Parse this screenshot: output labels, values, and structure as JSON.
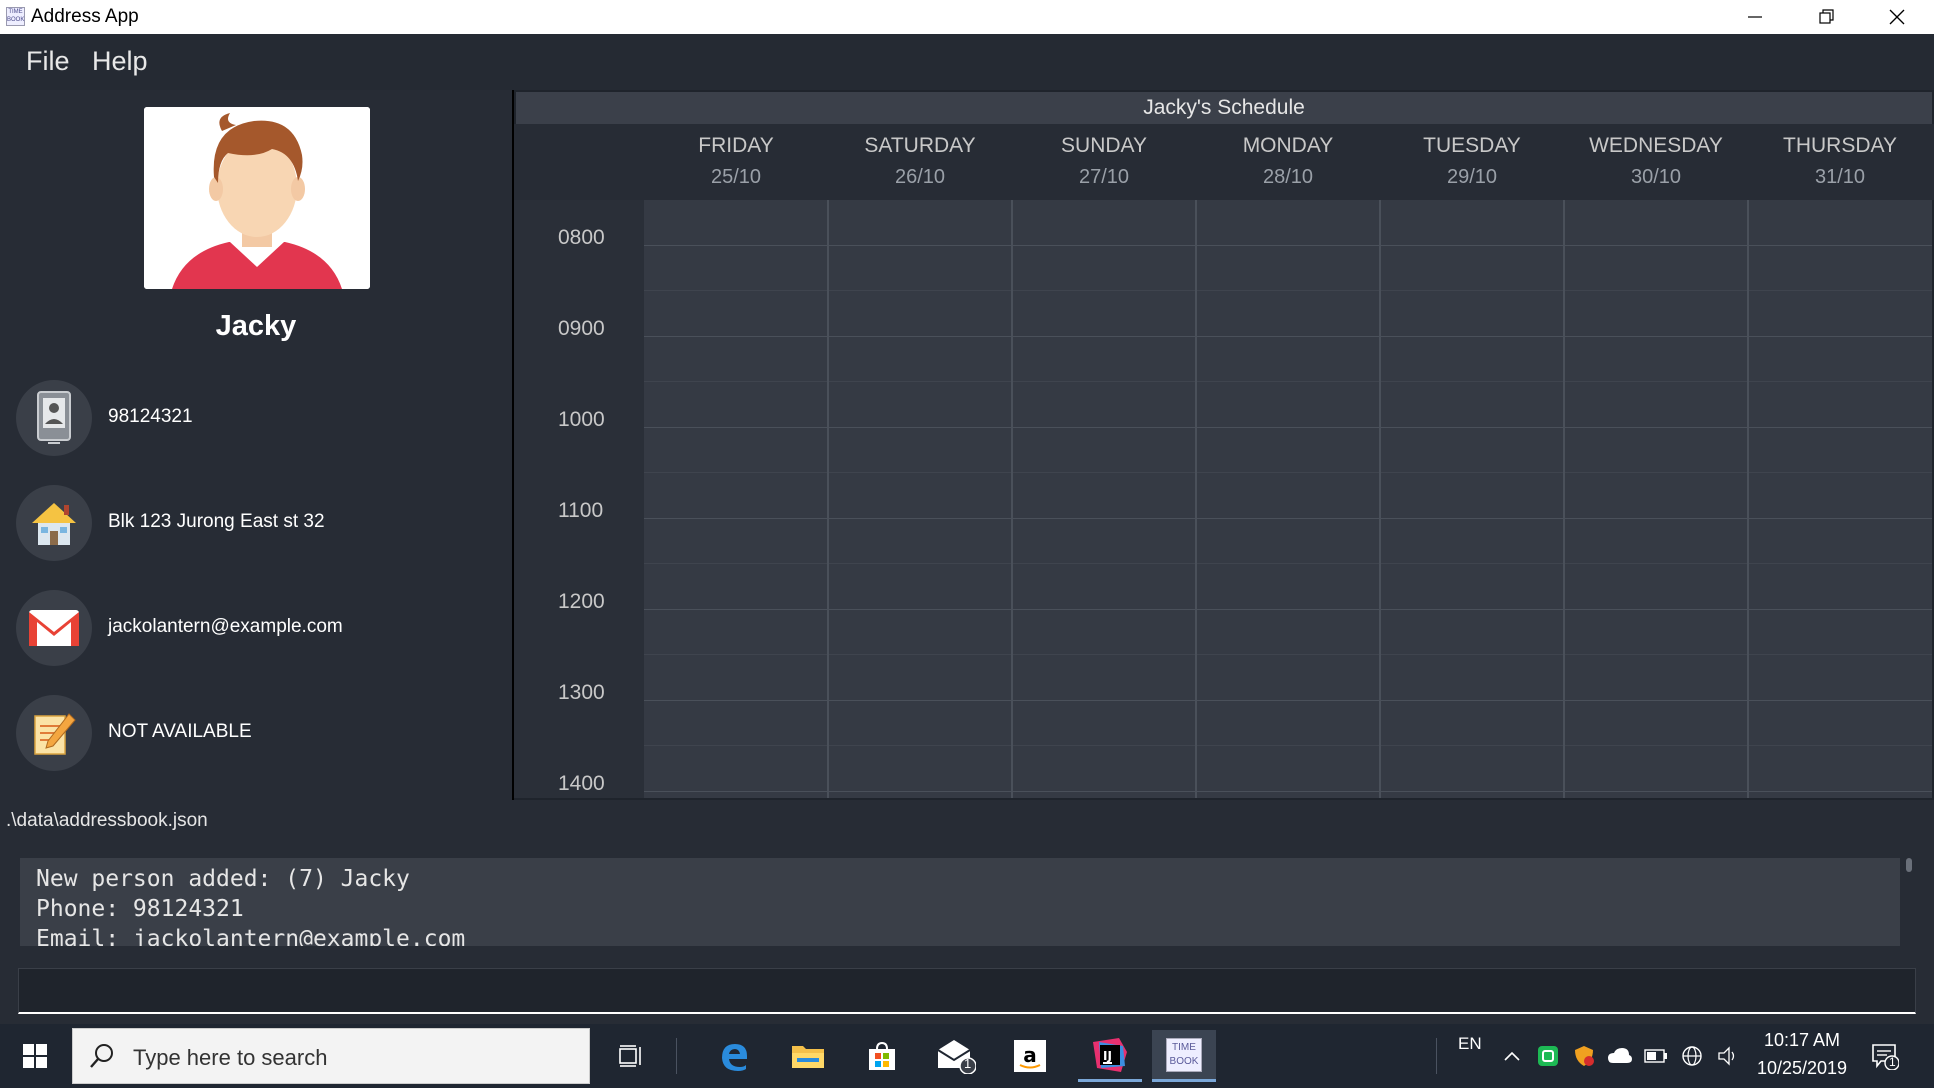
{
  "window": {
    "title": "Address App",
    "app_icon_text": "TIME BOOK",
    "controls": [
      "minimize",
      "restore",
      "close"
    ]
  },
  "menu": {
    "items": [
      "File",
      "Help"
    ]
  },
  "person": {
    "name": "Jacky",
    "phone": "98124321",
    "address": "Blk 123 Jurong East st 32",
    "email": "jackolantern@example.com",
    "remark": "NOT AVAILABLE"
  },
  "schedule": {
    "title": "Jacky's Schedule",
    "days": [
      {
        "name": "FRIDAY",
        "date": "25/10"
      },
      {
        "name": "SATURDAY",
        "date": "26/10"
      },
      {
        "name": "SUNDAY",
        "date": "27/10"
      },
      {
        "name": "MONDAY",
        "date": "28/10"
      },
      {
        "name": "TUESDAY",
        "date": "29/10"
      },
      {
        "name": "WEDNESDAY",
        "date": "30/10"
      },
      {
        "name": "THURSDAY",
        "date": "31/10"
      }
    ],
    "times": [
      "0800",
      "0900",
      "1000",
      "1100",
      "1200",
      "1300",
      "1400"
    ]
  },
  "status": {
    "path": ".\\data\\addressbook.json"
  },
  "result": {
    "lines": [
      "New person added: (7) Jacky",
      "Phone: 98124321",
      "Email: jackolantern@example.com"
    ]
  },
  "command": {
    "value": "",
    "placeholder": ""
  },
  "taskbar": {
    "search_placeholder": "Type here to search",
    "apps": [
      "task-view",
      "edge",
      "file-explorer",
      "store",
      "mail",
      "amazon",
      "intellij",
      "timebook"
    ],
    "mail_badge": "1",
    "language": "EN",
    "time": "10:17 AM",
    "date": "10/25/2019",
    "notification_badge": "1"
  },
  "colors": {
    "panel": "#272c35",
    "grid": "#353a44",
    "accent": "#7aa7d8"
  }
}
